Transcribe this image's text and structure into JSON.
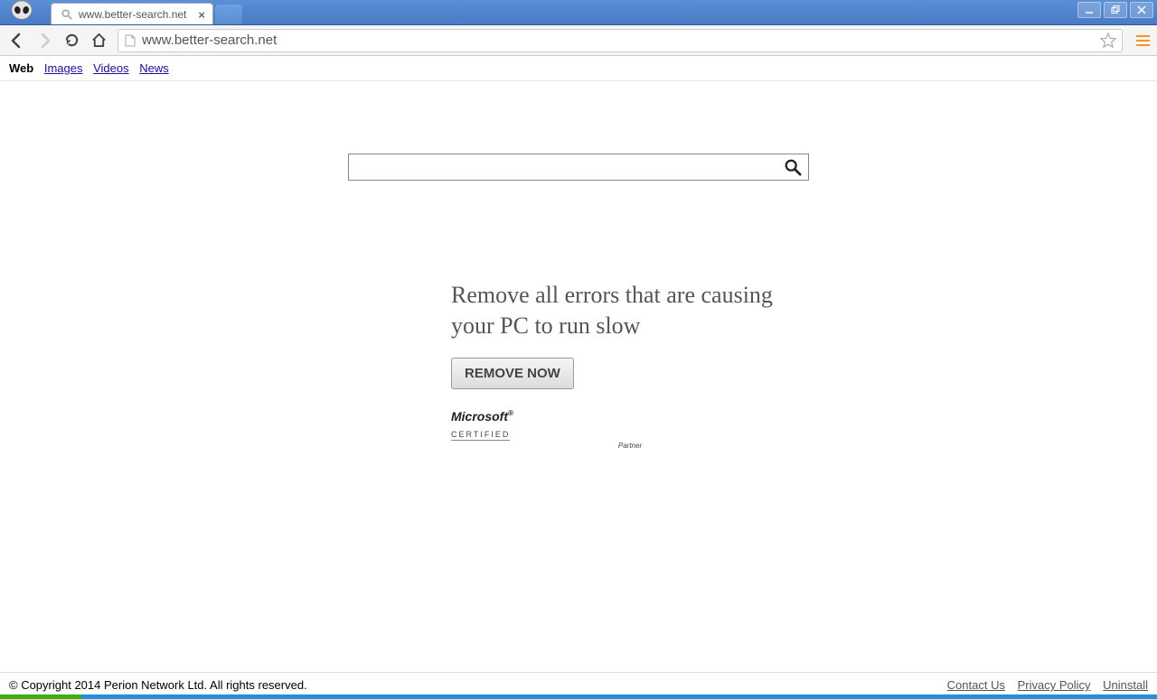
{
  "window": {
    "tab_title": "www.better-search.net",
    "address": "www.better-search.net"
  },
  "nav": {
    "items": [
      {
        "label": "Web",
        "active": true
      },
      {
        "label": "Images",
        "active": false
      },
      {
        "label": "Videos",
        "active": false
      },
      {
        "label": "News",
        "active": false
      }
    ]
  },
  "search": {
    "value": ""
  },
  "ad": {
    "headline": "Remove all errors that are causing your PC to run slow",
    "button": "REMOVE NOW",
    "logo_brand": "Microsoft",
    "logo_cert": "CERTIFIED",
    "logo_partner": "Partner"
  },
  "footer": {
    "copyright": "© Copyright 2014 Perion Network Ltd. All rights reserved.",
    "links": [
      {
        "label": "Contact Us"
      },
      {
        "label": "Privacy Policy"
      },
      {
        "label": "Uninstall"
      }
    ]
  }
}
